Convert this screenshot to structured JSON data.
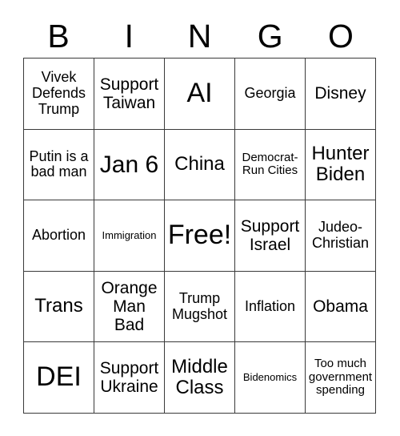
{
  "card": {
    "header_letters": [
      "B",
      "I",
      "N",
      "G",
      "O"
    ],
    "cells": [
      {
        "text": "Vivek Defends Trump",
        "size": "fs-s"
      },
      {
        "text": "Support Taiwan",
        "size": "fs-m"
      },
      {
        "text": "AI",
        "size": "fs-xxl"
      },
      {
        "text": "Georgia",
        "size": "fs-s"
      },
      {
        "text": "Disney",
        "size": "fs-m"
      },
      {
        "text": "Putin is a bad man",
        "size": "fs-s"
      },
      {
        "text": "Jan 6",
        "size": "fs-xl"
      },
      {
        "text": "China",
        "size": "fs-l"
      },
      {
        "text": "Democrat-Run Cities",
        "size": "fs-xs"
      },
      {
        "text": "Hunter Biden",
        "size": "fs-l"
      },
      {
        "text": "Abortion",
        "size": "fs-s"
      },
      {
        "text": "Immigration",
        "size": "fs-xxs"
      },
      {
        "text": "Free!",
        "size": "fs-xxl"
      },
      {
        "text": "Support Israel",
        "size": "fs-m"
      },
      {
        "text": "Judeo-Christian",
        "size": "fs-s"
      },
      {
        "text": "Trans",
        "size": "fs-l"
      },
      {
        "text": "Orange Man Bad",
        "size": "fs-m"
      },
      {
        "text": "Trump Mugshot",
        "size": "fs-s"
      },
      {
        "text": "Inflation",
        "size": "fs-s"
      },
      {
        "text": "Obama",
        "size": "fs-m"
      },
      {
        "text": "DEI",
        "size": "fs-xxl"
      },
      {
        "text": "Support Ukraine",
        "size": "fs-m"
      },
      {
        "text": "Middle Class",
        "size": "fs-l"
      },
      {
        "text": "Bidenomics",
        "size": "fs-xxs"
      },
      {
        "text": "Too much government spending",
        "size": "fs-xs"
      }
    ]
  }
}
